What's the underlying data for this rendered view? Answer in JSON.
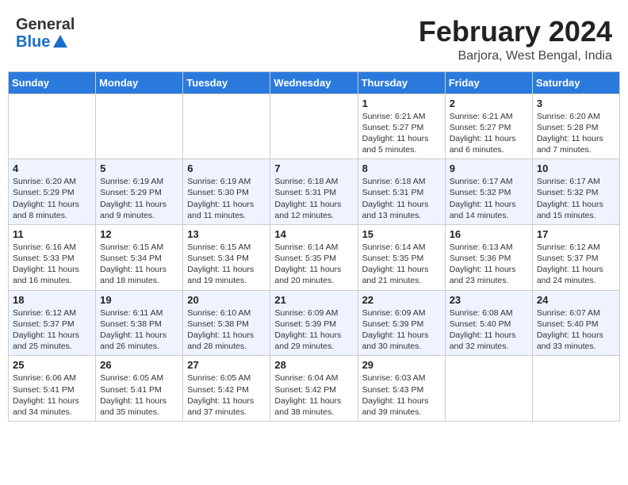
{
  "header": {
    "logo_general": "General",
    "logo_blue": "Blue",
    "month_title": "February 2024",
    "location": "Barjora, West Bengal, India"
  },
  "weekdays": [
    "Sunday",
    "Monday",
    "Tuesday",
    "Wednesday",
    "Thursday",
    "Friday",
    "Saturday"
  ],
  "weeks": [
    [
      {
        "day": "",
        "sunrise": "",
        "sunset": "",
        "daylight": ""
      },
      {
        "day": "",
        "sunrise": "",
        "sunset": "",
        "daylight": ""
      },
      {
        "day": "",
        "sunrise": "",
        "sunset": "",
        "daylight": ""
      },
      {
        "day": "",
        "sunrise": "",
        "sunset": "",
        "daylight": ""
      },
      {
        "day": "1",
        "sunrise": "Sunrise: 6:21 AM",
        "sunset": "Sunset: 5:27 PM",
        "daylight": "Daylight: 11 hours and 5 minutes."
      },
      {
        "day": "2",
        "sunrise": "Sunrise: 6:21 AM",
        "sunset": "Sunset: 5:27 PM",
        "daylight": "Daylight: 11 hours and 6 minutes."
      },
      {
        "day": "3",
        "sunrise": "Sunrise: 6:20 AM",
        "sunset": "Sunset: 5:28 PM",
        "daylight": "Daylight: 11 hours and 7 minutes."
      }
    ],
    [
      {
        "day": "4",
        "sunrise": "Sunrise: 6:20 AM",
        "sunset": "Sunset: 5:29 PM",
        "daylight": "Daylight: 11 hours and 8 minutes."
      },
      {
        "day": "5",
        "sunrise": "Sunrise: 6:19 AM",
        "sunset": "Sunset: 5:29 PM",
        "daylight": "Daylight: 11 hours and 9 minutes."
      },
      {
        "day": "6",
        "sunrise": "Sunrise: 6:19 AM",
        "sunset": "Sunset: 5:30 PM",
        "daylight": "Daylight: 11 hours and 11 minutes."
      },
      {
        "day": "7",
        "sunrise": "Sunrise: 6:18 AM",
        "sunset": "Sunset: 5:31 PM",
        "daylight": "Daylight: 11 hours and 12 minutes."
      },
      {
        "day": "8",
        "sunrise": "Sunrise: 6:18 AM",
        "sunset": "Sunset: 5:31 PM",
        "daylight": "Daylight: 11 hours and 13 minutes."
      },
      {
        "day": "9",
        "sunrise": "Sunrise: 6:17 AM",
        "sunset": "Sunset: 5:32 PM",
        "daylight": "Daylight: 11 hours and 14 minutes."
      },
      {
        "day": "10",
        "sunrise": "Sunrise: 6:17 AM",
        "sunset": "Sunset: 5:32 PM",
        "daylight": "Daylight: 11 hours and 15 minutes."
      }
    ],
    [
      {
        "day": "11",
        "sunrise": "Sunrise: 6:16 AM",
        "sunset": "Sunset: 5:33 PM",
        "daylight": "Daylight: 11 hours and 16 minutes."
      },
      {
        "day": "12",
        "sunrise": "Sunrise: 6:15 AM",
        "sunset": "Sunset: 5:34 PM",
        "daylight": "Daylight: 11 hours and 18 minutes."
      },
      {
        "day": "13",
        "sunrise": "Sunrise: 6:15 AM",
        "sunset": "Sunset: 5:34 PM",
        "daylight": "Daylight: 11 hours and 19 minutes."
      },
      {
        "day": "14",
        "sunrise": "Sunrise: 6:14 AM",
        "sunset": "Sunset: 5:35 PM",
        "daylight": "Daylight: 11 hours and 20 minutes."
      },
      {
        "day": "15",
        "sunrise": "Sunrise: 6:14 AM",
        "sunset": "Sunset: 5:35 PM",
        "daylight": "Daylight: 11 hours and 21 minutes."
      },
      {
        "day": "16",
        "sunrise": "Sunrise: 6:13 AM",
        "sunset": "Sunset: 5:36 PM",
        "daylight": "Daylight: 11 hours and 23 minutes."
      },
      {
        "day": "17",
        "sunrise": "Sunrise: 6:12 AM",
        "sunset": "Sunset: 5:37 PM",
        "daylight": "Daylight: 11 hours and 24 minutes."
      }
    ],
    [
      {
        "day": "18",
        "sunrise": "Sunrise: 6:12 AM",
        "sunset": "Sunset: 5:37 PM",
        "daylight": "Daylight: 11 hours and 25 minutes."
      },
      {
        "day": "19",
        "sunrise": "Sunrise: 6:11 AM",
        "sunset": "Sunset: 5:38 PM",
        "daylight": "Daylight: 11 hours and 26 minutes."
      },
      {
        "day": "20",
        "sunrise": "Sunrise: 6:10 AM",
        "sunset": "Sunset: 5:38 PM",
        "daylight": "Daylight: 11 hours and 28 minutes."
      },
      {
        "day": "21",
        "sunrise": "Sunrise: 6:09 AM",
        "sunset": "Sunset: 5:39 PM",
        "daylight": "Daylight: 11 hours and 29 minutes."
      },
      {
        "day": "22",
        "sunrise": "Sunrise: 6:09 AM",
        "sunset": "Sunset: 5:39 PM",
        "daylight": "Daylight: 11 hours and 30 minutes."
      },
      {
        "day": "23",
        "sunrise": "Sunrise: 6:08 AM",
        "sunset": "Sunset: 5:40 PM",
        "daylight": "Daylight: 11 hours and 32 minutes."
      },
      {
        "day": "24",
        "sunrise": "Sunrise: 6:07 AM",
        "sunset": "Sunset: 5:40 PM",
        "daylight": "Daylight: 11 hours and 33 minutes."
      }
    ],
    [
      {
        "day": "25",
        "sunrise": "Sunrise: 6:06 AM",
        "sunset": "Sunset: 5:41 PM",
        "daylight": "Daylight: 11 hours and 34 minutes."
      },
      {
        "day": "26",
        "sunrise": "Sunrise: 6:05 AM",
        "sunset": "Sunset: 5:41 PM",
        "daylight": "Daylight: 11 hours and 35 minutes."
      },
      {
        "day": "27",
        "sunrise": "Sunrise: 6:05 AM",
        "sunset": "Sunset: 5:42 PM",
        "daylight": "Daylight: 11 hours and 37 minutes."
      },
      {
        "day": "28",
        "sunrise": "Sunrise: 6:04 AM",
        "sunset": "Sunset: 5:42 PM",
        "daylight": "Daylight: 11 hours and 38 minutes."
      },
      {
        "day": "29",
        "sunrise": "Sunrise: 6:03 AM",
        "sunset": "Sunset: 5:43 PM",
        "daylight": "Daylight: 11 hours and 39 minutes."
      },
      {
        "day": "",
        "sunrise": "",
        "sunset": "",
        "daylight": ""
      },
      {
        "day": "",
        "sunrise": "",
        "sunset": "",
        "daylight": ""
      }
    ]
  ]
}
